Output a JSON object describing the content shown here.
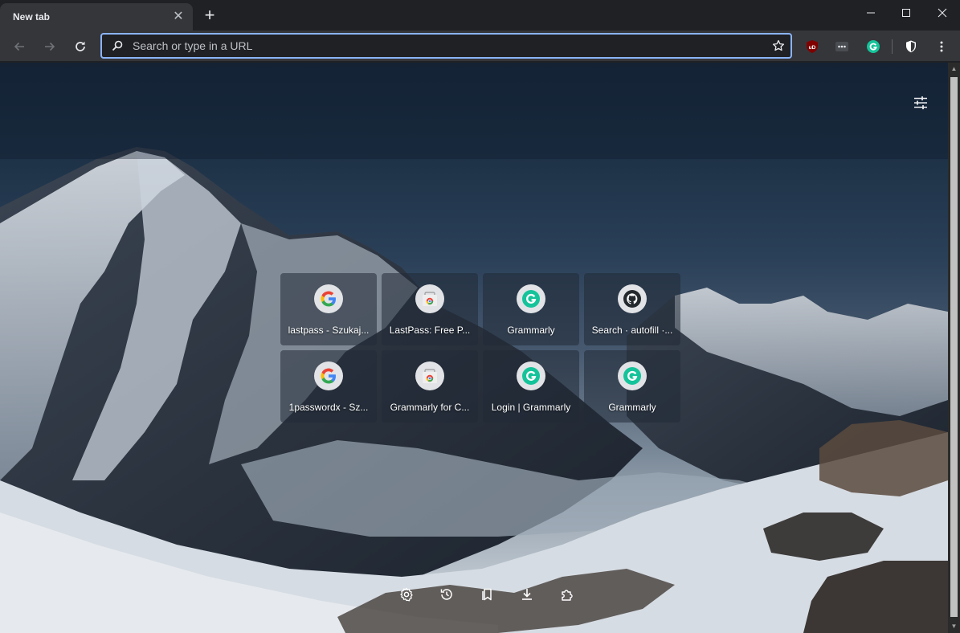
{
  "browser": {
    "tab": {
      "title": "New tab",
      "close_glyph": "✕"
    },
    "new_tab_glyph": "+",
    "window_controls": [
      "minimize-icon",
      "maximize-icon",
      "close-icon"
    ]
  },
  "toolbar": {
    "back_icon": "arrow-left-icon",
    "forward_icon": "arrow-right-icon",
    "reload_icon": "reload-icon",
    "omnibox": {
      "placeholder": "Search or type in a URL",
      "value": ""
    },
    "bookmark_icon": "star-icon",
    "extensions": [
      {
        "name": "ublock-origin",
        "label": "uD",
        "color": "#800000"
      },
      {
        "name": "lastpass-dots",
        "label": "•••",
        "color": "#4a4d52"
      },
      {
        "name": "grammarly",
        "label": "G",
        "color": "#15c39a"
      },
      {
        "name": "shield",
        "label": "",
        "color": "#ffffff"
      }
    ],
    "menu_icon": "kebab-menu-icon"
  },
  "ntp": {
    "customize_icon": "sliders-icon",
    "shortcuts": [
      {
        "label": "lastpass - Szukaj...",
        "icon": "google"
      },
      {
        "label": "LastPass: Free P...",
        "icon": "chrome-webstore"
      },
      {
        "label": "Grammarly",
        "icon": "grammarly"
      },
      {
        "label": "Search · autofill ·...",
        "icon": "github"
      },
      {
        "label": "1passwordx - Sz...",
        "icon": "google"
      },
      {
        "label": "Grammarly for C...",
        "icon": "chrome-webstore"
      },
      {
        "label": "Login | Grammarly",
        "icon": "grammarly"
      },
      {
        "label": "Grammarly",
        "icon": "grammarly"
      }
    ],
    "bottom_bar": [
      "settings-icon",
      "history-icon",
      "bookmarks-icon",
      "downloads-icon",
      "extensions-icon"
    ]
  },
  "colors": {
    "accent": "#8ab4f8",
    "grammarly": "#15c39a",
    "ublock": "#800000"
  }
}
